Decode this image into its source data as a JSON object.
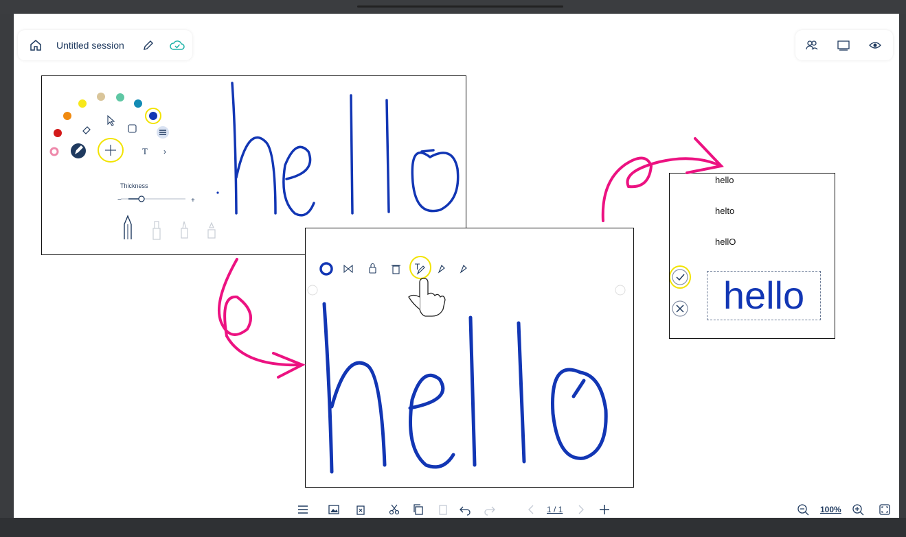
{
  "session": {
    "title": "Untitled session"
  },
  "panel1": {
    "thickness_label": "Thickness",
    "minus": "−",
    "plus": "+",
    "text_tool": "T",
    "more": "›",
    "handwriting": "hello",
    "palette": [
      "#d31a1a",
      "#f08a10",
      "#f7e81a",
      "#d9c59a",
      "#5fc7a4",
      "#138bb4",
      "#1236b4"
    ]
  },
  "panel2": {
    "handwriting": "hello"
  },
  "panel3": {
    "candidates": [
      "hello",
      "helto",
      "hellO"
    ],
    "converted": "hello"
  },
  "toolbar": {
    "pager": "1 / 1",
    "zoom": "100%"
  },
  "colors": {
    "ink": "#1236b4",
    "arrow": "#ec1281",
    "highlight": "#f2e300",
    "ui": "#1f3a5f"
  }
}
